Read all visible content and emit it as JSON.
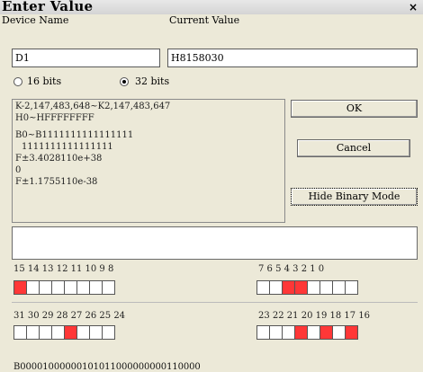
{
  "window": {
    "title": "Enter Value",
    "close_glyph": "×"
  },
  "labels": {
    "device_name": "Device Name",
    "current_value": "Current Value"
  },
  "fields": {
    "device_name": "D1",
    "current_value": "H8158030"
  },
  "mode": {
    "bits16": "16 bits",
    "bits32": "32 bits",
    "selected": "32 bits"
  },
  "range_info": {
    "line1": "K-2,147,483,648~K2,147,483,647",
    "line2": "H0~HFFFFFFFF",
    "line3": "B0~B1111111111111111",
    "line4": "1111111111111111",
    "line5": "F±3.4028110e+38",
    "line6": "0",
    "line7": "F±1.1755110e-38"
  },
  "buttons": {
    "ok": "OK",
    "cancel": "Cancel",
    "binary_mode": "Hide Binary Mode"
  },
  "memo": {
    "text": ""
  },
  "bit_labels": {
    "row1_left": "15  14  13  12   11  10   9    8",
    "row1_right": "7    6    5    4     3    2    1    0",
    "row2_left": "31  30  29  28  27  26  25  24",
    "row2_right": "23  22  21  20  19  18  17  16"
  },
  "bits": {
    "row1_left": [
      1,
      0,
      0,
      0,
      0,
      0,
      0,
      0
    ],
    "row1_right": [
      0,
      0,
      1,
      1,
      0,
      0,
      0,
      0
    ],
    "row2_left": [
      0,
      0,
      0,
      0,
      1,
      0,
      0,
      0
    ],
    "row2_right": [
      0,
      0,
      0,
      1,
      0,
      1,
      0,
      1
    ]
  },
  "colors": {
    "bit_on": "#ff3737",
    "bit_off": "#ffffff",
    "dialog_bg": "#ece9d8"
  },
  "binary_string": "B00001000000101011000000000110000"
}
